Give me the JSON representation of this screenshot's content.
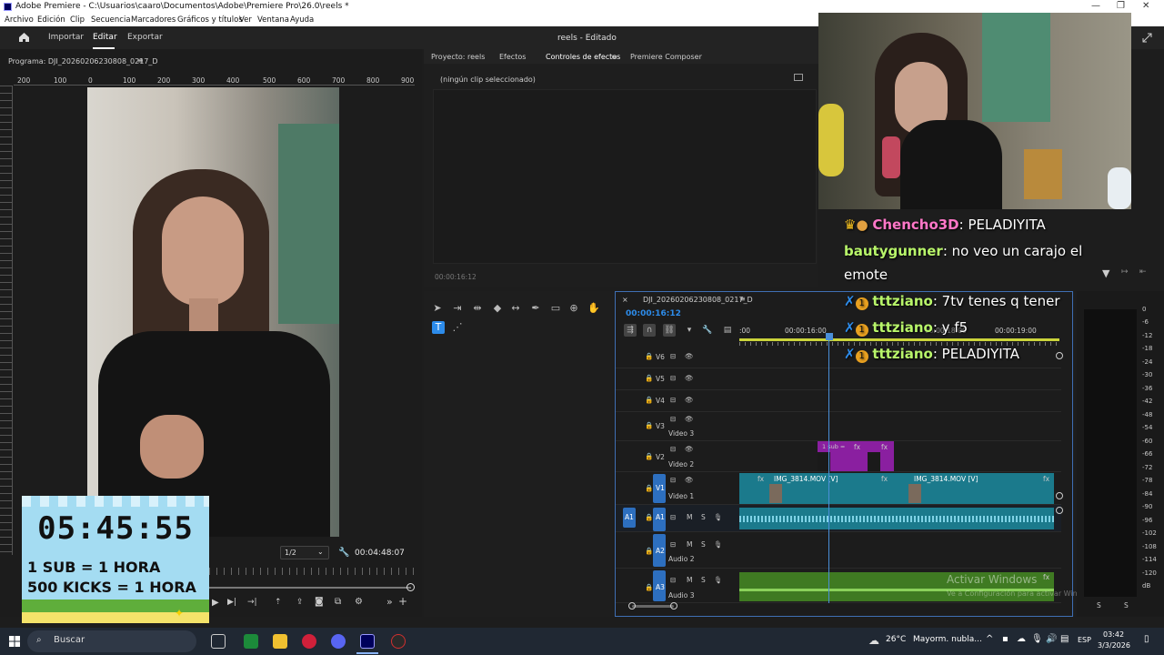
{
  "window": {
    "title": "Adobe Premiere - C:\\Usuarios\\caaro\\Documentos\\Adobe\\Premiere Pro\\26.0\\reels *"
  },
  "menu": [
    "Archivo",
    "Edición",
    "Clip",
    "Secuencia",
    "Marcadores",
    "Gráficos y títulos",
    "Ver",
    "Ventana",
    "Ayuda"
  ],
  "header": {
    "home_icon": "home-icon",
    "nav": [
      "Importar",
      "Editar",
      "Exportar"
    ],
    "active": "Editar",
    "project_title": "reels - Editado"
  },
  "program_monitor": {
    "label": "Programa: DJI_20260206230808_0217_D",
    "ruler_ticks": [
      "200",
      "100",
      "0",
      "100",
      "200",
      "300",
      "400",
      "500",
      "600",
      "700",
      "800",
      "900",
      "00"
    ],
    "zoom": "1/2",
    "duration": "00:04:48:07"
  },
  "timer_overlay": {
    "clock": "05:45:55",
    "line1": "1 SUB = 1 HORA",
    "line2": "500 KICKS = 1 HORA"
  },
  "effects_panel": {
    "tabs": [
      "Proyecto: reels",
      "Efectos",
      "Controles de efectos",
      "Premiere Composer"
    ],
    "active_tab": "Controles de efectos",
    "empty_message": "(ningún clip seleccionado)",
    "timecode": "00:00:16:12"
  },
  "sequence": {
    "name": "DJI_20260206230808_0217_D",
    "timecode": "00:00:16:12",
    "ruler": [
      ":00",
      "00:00:16:00",
      "00:00:18:00",
      "00:00:19:00"
    ],
    "tracks": [
      {
        "id": "V6",
        "name": ""
      },
      {
        "id": "V5",
        "name": ""
      },
      {
        "id": "V4",
        "name": ""
      },
      {
        "id": "V3",
        "name": "Video 3"
      },
      {
        "id": "V2",
        "name": "Video 2"
      },
      {
        "id": "V1",
        "name": "Video 1"
      },
      {
        "id": "A1",
        "name": ""
      },
      {
        "id": "A2",
        "name": "Audio 2"
      },
      {
        "id": "A3",
        "name": "Audio 3"
      }
    ],
    "track_buttons": {
      "mute": "M",
      "solo": "S"
    },
    "source_patch": "A1",
    "clips": {
      "v2_label": "1 sub =",
      "fx": "fx",
      "v1_a": "IMG_3814.MOV [V]",
      "v1_b": "IMG_3814.MOV [V]"
    },
    "watermark_line1": "Activar Windows",
    "watermark_line2": "Ve a Configuración para activar Windows."
  },
  "meters": {
    "scale": [
      "0",
      "-6",
      "-12",
      "-18",
      "-24",
      "-30",
      "-36",
      "-42",
      "-48",
      "-54",
      "-60",
      "-66",
      "-72",
      "-78",
      "-84",
      "-90",
      "-96",
      "-102",
      "-108",
      "-114",
      "-120",
      "dB"
    ],
    "footer": [
      "S",
      "S"
    ]
  },
  "chat": [
    {
      "user": "Chencho3D",
      "user_color": "#ff77c8",
      "message": ": PELADIYITA",
      "badges": [
        "crown",
        "emote"
      ]
    },
    {
      "user": "bautygunner",
      "user_color": "#b8f56a",
      "message": ": no veo un carajo el emote",
      "badges": []
    },
    {
      "user": "tttziano",
      "user_color": "#b8f56a",
      "message": ": 7tv tenes q tener",
      "badges": [
        "sword",
        "1"
      ]
    },
    {
      "user": "tttziano",
      "user_color": "#b8f56a",
      "message": ": y f5",
      "badges": [
        "sword",
        "1"
      ]
    },
    {
      "user": "tttziano",
      "user_color": "#b8f56a",
      "message": ": PELADIYITA",
      "badges": [
        "sword",
        "1"
      ]
    }
  ],
  "taskbar": {
    "search": "Buscar",
    "weather": "26°C",
    "weather_desc": "Mayorm. nubla...",
    "lang": "ESP",
    "time": "03:42",
    "date": "3/3/2026"
  },
  "colors": {
    "accent": "#2d8ceb",
    "teal_clip": "#1b7a8c",
    "purple_clip": "#8a1fa0",
    "green_audio": "#3f7a22"
  }
}
